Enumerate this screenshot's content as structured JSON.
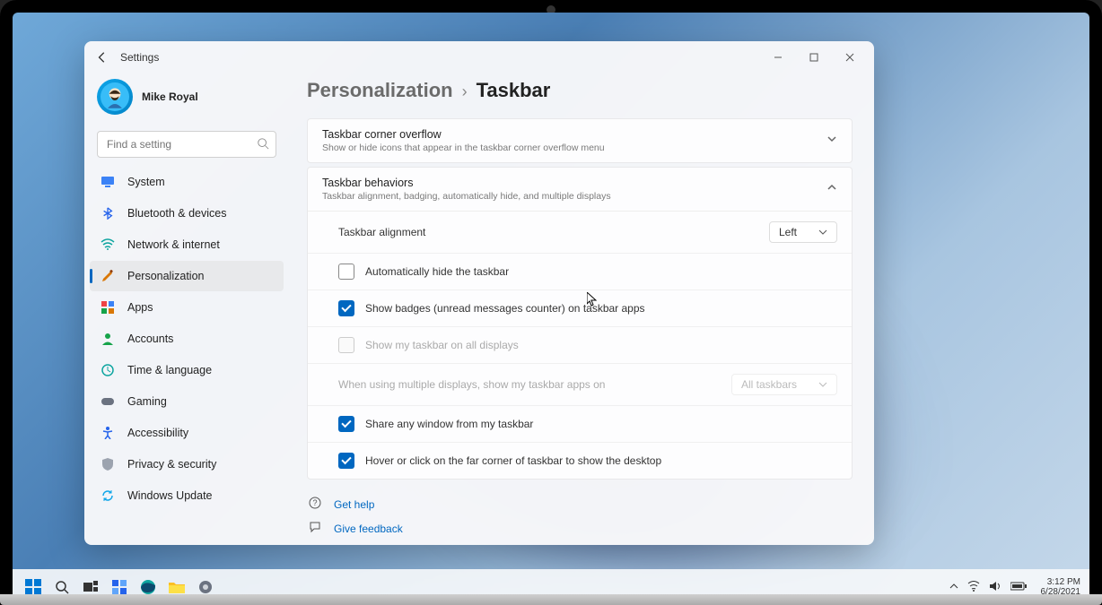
{
  "app": {
    "title": "Settings"
  },
  "profile": {
    "name": "Mike Royal"
  },
  "search": {
    "placeholder": "Find a setting"
  },
  "nav": {
    "system": "System",
    "bluetooth": "Bluetooth & devices",
    "network": "Network & internet",
    "personalization": "Personalization",
    "apps": "Apps",
    "accounts": "Accounts",
    "time": "Time & language",
    "gaming": "Gaming",
    "accessibility": "Accessibility",
    "privacy": "Privacy & security",
    "update": "Windows Update"
  },
  "breadcrumb": {
    "parent": "Personalization",
    "sep": "›",
    "current": "Taskbar"
  },
  "cards": {
    "overflow": {
      "title": "Taskbar corner overflow",
      "sub": "Show or hide icons that appear in the taskbar corner overflow menu"
    },
    "behaviors": {
      "title": "Taskbar behaviors",
      "sub": "Taskbar alignment, badging, automatically hide, and multiple displays"
    }
  },
  "rows": {
    "alignment": {
      "label": "Taskbar alignment",
      "value": "Left"
    },
    "autohide": "Automatically hide the taskbar",
    "badges": "Show badges (unread messages counter) on taskbar apps",
    "multiDisplay": "Show my taskbar on all displays",
    "multiDisplayApps": {
      "label": "When using multiple displays, show my taskbar apps on",
      "value": "All taskbars"
    },
    "shareWindow": "Share any window from my taskbar",
    "peekDesktop": "Hover or click on the far corner of taskbar to show the desktop"
  },
  "help": {
    "getHelp": "Get help",
    "feedback": "Give feedback"
  },
  "tray": {
    "time": "3:12 PM",
    "date": "6/28/2021"
  }
}
